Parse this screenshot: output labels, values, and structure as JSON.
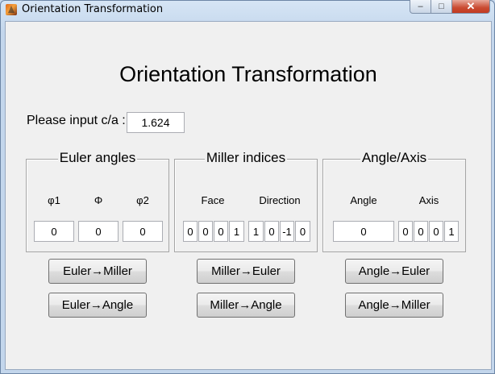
{
  "window": {
    "title": "Orientation Transformation",
    "controls": {
      "minimize": "–",
      "maximize": "□",
      "close": "✕"
    }
  },
  "main": {
    "heading": "Orientation Transformation",
    "ca": {
      "label": "Please input c/a :",
      "value": "1.624"
    }
  },
  "euler": {
    "title": "Euler angles",
    "labels": [
      "φ1",
      "Φ",
      "φ2"
    ],
    "values": [
      "0",
      "0",
      "0"
    ]
  },
  "miller": {
    "title": "Miller indices",
    "face_label": "Face",
    "direction_label": "Direction",
    "face_values": [
      "0",
      "0",
      "0",
      "1"
    ],
    "direction_values": [
      "1",
      "0",
      "-1",
      "0"
    ]
  },
  "angleaxis": {
    "title": "Angle/Axis",
    "angle_label": "Angle",
    "axis_label": "Axis",
    "angle_value": "0",
    "axis_values": [
      "0",
      "0",
      "0",
      "1"
    ]
  },
  "buttons": {
    "euler_miller": "Euler→Miller",
    "euler_angle": "Euler→Angle",
    "miller_euler": "Miller→Euler",
    "miller_angle": "Miller→Angle",
    "angle_euler": "Angle→Euler",
    "angle_miller": "Angle→Miller"
  }
}
